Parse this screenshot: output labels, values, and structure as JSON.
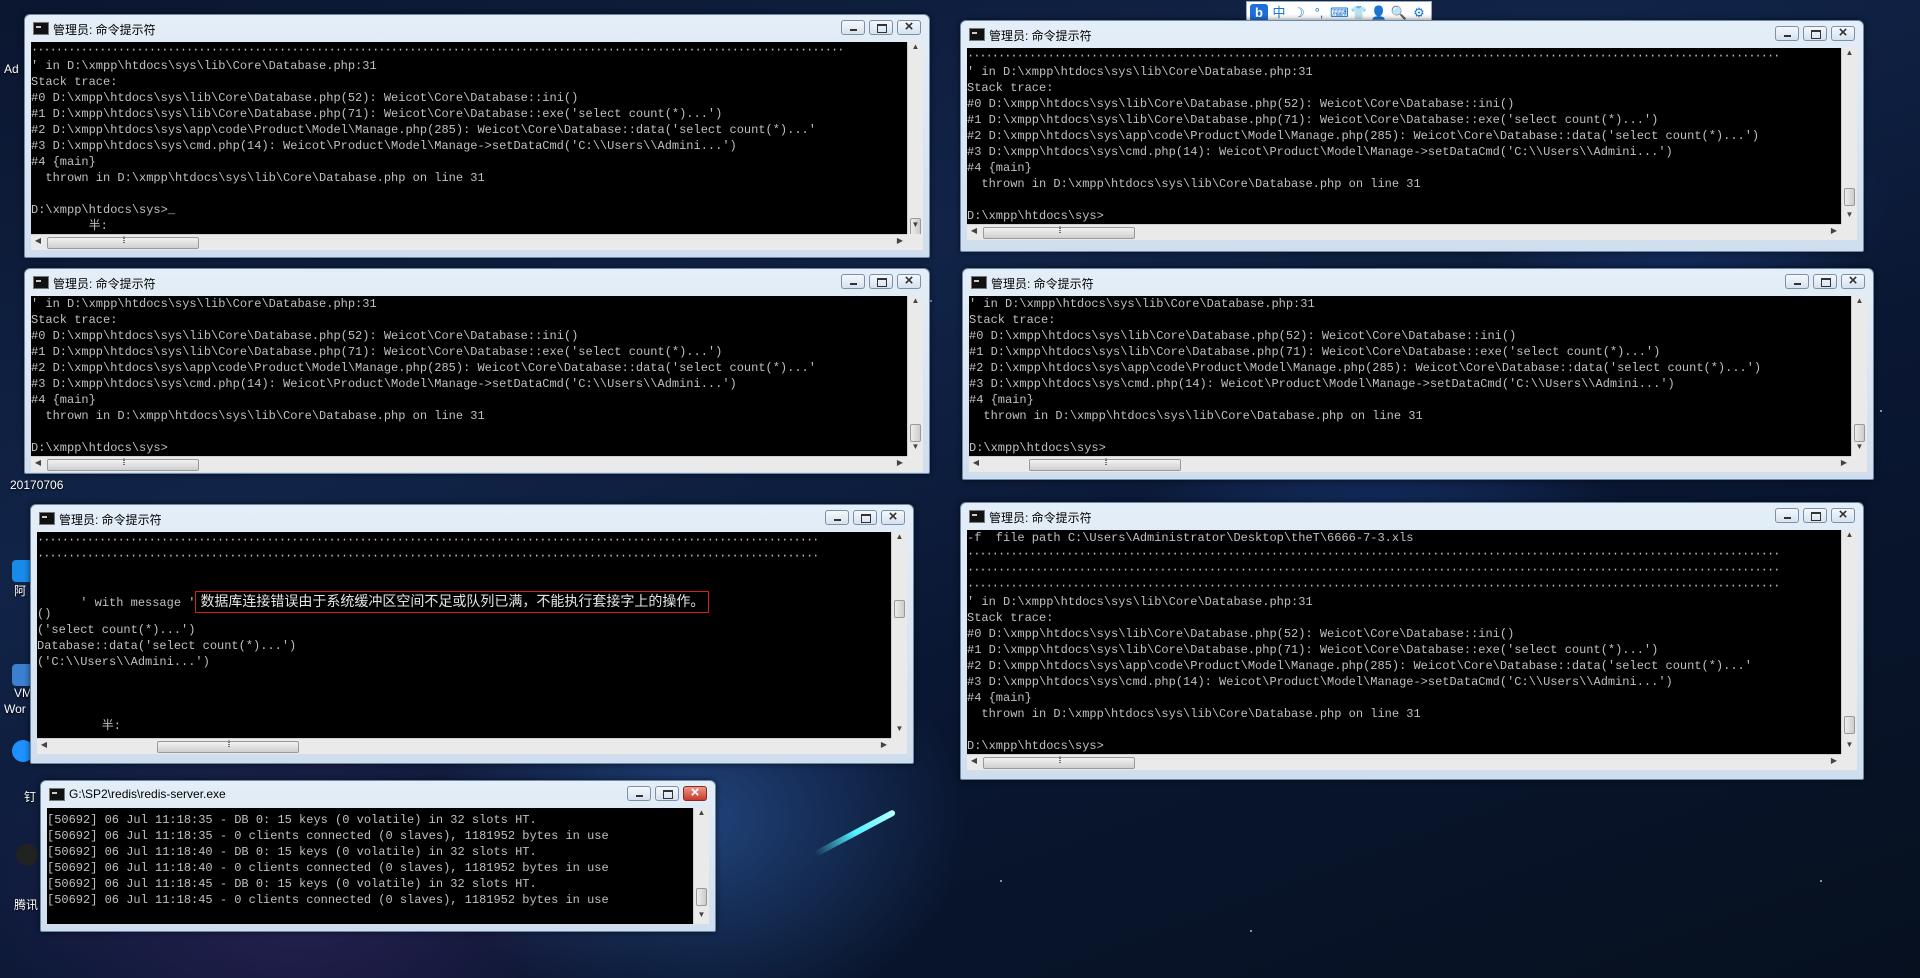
{
  "desktop": {
    "labels": [
      "Ad",
      "20170706",
      "阿",
      "VM",
      "Wor",
      "钉",
      "腾讯"
    ]
  },
  "ime_toolbar": {
    "logo": "b",
    "lang": "中",
    "moon": "☽",
    "punct": "°,",
    "keyboard": "⌨",
    "skin": "👕",
    "user": "👤",
    "search": "🔍",
    "settings": "⚙"
  },
  "windows": {
    "w1": {
      "title": "管理员: 命令提示符",
      "lines": [
        "' in D:\\xmpp\\htdocs\\sys\\lib\\Core\\Database.php:31",
        "Stack trace:",
        "#0 D:\\xmpp\\htdocs\\sys\\lib\\Core\\Database.php(52): Weicot\\Core\\Database::ini()",
        "#1 D:\\xmpp\\htdocs\\sys\\lib\\Core\\Database.php(71): Weicot\\Core\\Database::exe('select count(*)...')",
        "#2 D:\\xmpp\\htdocs\\sys\\app\\code\\Product\\Model\\Manage.php(285): Weicot\\Core\\Database::data('select count(*)...'",
        "#3 D:\\xmpp\\htdocs\\sys\\cmd.php(14): Weicot\\Product\\Model\\Manage->setDataCmd('C:\\\\Users\\\\Admini...')",
        "#4 {main}",
        "  thrown in D:\\xmpp\\htdocs\\sys\\lib\\Core\\Database.php on line 31",
        "",
        "D:\\xmpp\\htdocs\\sys>_",
        "        半:"
      ]
    },
    "w2": {
      "title": "管理员: 命令提示符",
      "lines": [
        "' in D:\\xmpp\\htdocs\\sys\\lib\\Core\\Database.php:31",
        "Stack trace:",
        "#0 D:\\xmpp\\htdocs\\sys\\lib\\Core\\Database.php(52): Weicot\\Core\\Database::ini()",
        "#1 D:\\xmpp\\htdocs\\sys\\lib\\Core\\Database.php(71): Weicot\\Core\\Database::exe('select count(*)...')",
        "#2 D:\\xmpp\\htdocs\\sys\\app\\code\\Product\\Model\\Manage.php(285): Weicot\\Core\\Database::data('select count(*)...'",
        "#3 D:\\xmpp\\htdocs\\sys\\cmd.php(14): Weicot\\Product\\Model\\Manage->setDataCmd('C:\\\\Users\\\\Admini...')",
        "#4 {main}",
        "  thrown in D:\\xmpp\\htdocs\\sys\\lib\\Core\\Database.php on line 31",
        "",
        "D:\\xmpp\\htdocs\\sys>"
      ]
    },
    "w3": {
      "title": "管理员: 命令提示符",
      "message_prefix": "' with message '",
      "message_text": "数据库连接错误由于系统缓冲区空间不足或队列已满，不能执行套接字上的操作。",
      "lines": [
        "",
        "()",
        "('select count(*)...')",
        "Database::data('select count(*)...')",
        "('C:\\\\Users\\\\Admini...')",
        "",
        "",
        "",
        "         半:"
      ]
    },
    "w4": {
      "title": "G:\\SP2\\redis\\redis-server.exe",
      "lines": [
        "[50692] 06 Jul 11:18:35 - DB 0: 15 keys (0 volatile) in 32 slots HT.",
        "[50692] 06 Jul 11:18:35 - 0 clients connected (0 slaves), 1181952 bytes in use",
        "[50692] 06 Jul 11:18:40 - DB 0: 15 keys (0 volatile) in 32 slots HT.",
        "[50692] 06 Jul 11:18:40 - 0 clients connected (0 slaves), 1181952 bytes in use",
        "[50692] 06 Jul 11:18:45 - DB 0: 15 keys (0 volatile) in 32 slots HT.",
        "[50692] 06 Jul 11:18:45 - 0 clients connected (0 slaves), 1181952 bytes in use"
      ]
    },
    "w5": {
      "title": "管理员: 命令提示符",
      "lines": [
        "' in D:\\xmpp\\htdocs\\sys\\lib\\Core\\Database.php:31",
        "Stack trace:",
        "#0 D:\\xmpp\\htdocs\\sys\\lib\\Core\\Database.php(52): Weicot\\Core\\Database::ini()",
        "#1 D:\\xmpp\\htdocs\\sys\\lib\\Core\\Database.php(71): Weicot\\Core\\Database::exe('select count(*)...')",
        "#2 D:\\xmpp\\htdocs\\sys\\app\\code\\Product\\Model\\Manage.php(285): Weicot\\Core\\Database::data('select count(*)...')",
        "#3 D:\\xmpp\\htdocs\\sys\\cmd.php(14): Weicot\\Product\\Model\\Manage->setDataCmd('C:\\\\Users\\\\Admini...')",
        "#4 {main}",
        "  thrown in D:\\xmpp\\htdocs\\sys\\lib\\Core\\Database.php on line 31",
        "",
        "D:\\xmpp\\htdocs\\sys>"
      ]
    },
    "w6": {
      "title": "管理员: 命令提示符",
      "lines": [
        "' in D:\\xmpp\\htdocs\\sys\\lib\\Core\\Database.php:31",
        "Stack trace:",
        "#0 D:\\xmpp\\htdocs\\sys\\lib\\Core\\Database.php(52): Weicot\\Core\\Database::ini()",
        "#1 D:\\xmpp\\htdocs\\sys\\lib\\Core\\Database.php(71): Weicot\\Core\\Database::exe('select count(*)...')",
        "#2 D:\\xmpp\\htdocs\\sys\\app\\code\\Product\\Model\\Manage.php(285): Weicot\\Core\\Database::data('select count(*)...')",
        "#3 D:\\xmpp\\htdocs\\sys\\cmd.php(14): Weicot\\Product\\Model\\Manage->setDataCmd('C:\\\\Users\\\\Admini...')",
        "#4 {main}",
        "  thrown in D:\\xmpp\\htdocs\\sys\\lib\\Core\\Database.php on line 31",
        "",
        "D:\\xmpp\\htdocs\\sys>"
      ]
    },
    "w7": {
      "title": "管理员: 命令提示符",
      "lines": [
        "-f  file path C:\\Users\\Administrator\\Desktop\\theT\\6666-7-3.xls",
        "",
        "",
        "",
        "' in D:\\xmpp\\htdocs\\sys\\lib\\Core\\Database.php:31",
        "Stack trace:",
        "#0 D:\\xmpp\\htdocs\\sys\\lib\\Core\\Database.php(52): Weicot\\Core\\Database::ini()",
        "#1 D:\\xmpp\\htdocs\\sys\\lib\\Core\\Database.php(71): Weicot\\Core\\Database::exe('select count(*)...')",
        "#2 D:\\xmpp\\htdocs\\sys\\app\\code\\Product\\Model\\Manage.php(285): Weicot\\Core\\Database::data('select count(*)...'",
        "#3 D:\\xmpp\\htdocs\\sys\\cmd.php(14): Weicot\\Product\\Model\\Manage->setDataCmd('C:\\\\Users\\\\Admini...')",
        "#4 {main}",
        "  thrown in D:\\xmpp\\htdocs\\sys\\lib\\Core\\Database.php on line 31",
        "",
        "D:\\xmpp\\htdocs\\sys>"
      ]
    }
  },
  "colors": {
    "console_bg": "#000000",
    "console_fg": "#c0c0c0",
    "error_outline": "#d02020",
    "close_button_active": "#c8392a"
  }
}
